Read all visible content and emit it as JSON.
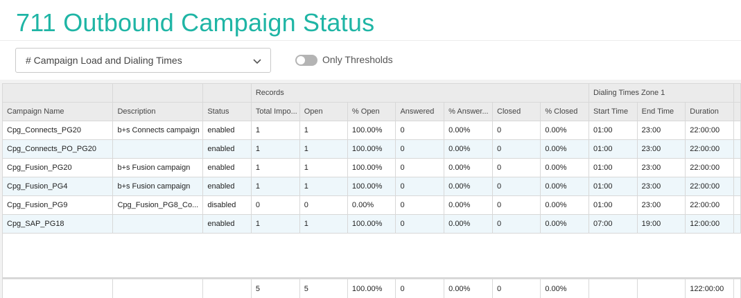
{
  "page": {
    "title": "711 Outbound Campaign Status"
  },
  "toolbar": {
    "view_select": {
      "value": "# Campaign Load and Dialing Times",
      "icon": "chevron-down-icon"
    },
    "threshold_toggle": {
      "label": "Only Thresholds",
      "state": "off"
    }
  },
  "colors": {
    "title": "#1fb5a5",
    "header_bg": "#ebebeb",
    "alt_row_bg": "#eef7fb"
  },
  "grid": {
    "group_headers": {
      "records": "Records",
      "dialing": "Dialing Times Zone 1"
    },
    "columns": [
      "Campaign Name",
      "Description",
      "Status",
      "Total Impo...",
      "Open",
      "% Open",
      "Answered",
      "% Answer...",
      "Closed",
      "% Closed",
      "Start Time",
      "End Time",
      "Duration"
    ],
    "rows": [
      [
        "Cpg_Connects_PG20",
        "b+s Connects campaign",
        "enabled",
        "1",
        "1",
        "100.00%",
        "0",
        "0.00%",
        "0",
        "0.00%",
        "01:00",
        "23:00",
        "22:00:00"
      ],
      [
        "Cpg_Connects_PO_PG20",
        "",
        "enabled",
        "1",
        "1",
        "100.00%",
        "0",
        "0.00%",
        "0",
        "0.00%",
        "01:00",
        "23:00",
        "22:00:00"
      ],
      [
        "Cpg_Fusion_PG20",
        "b+s Fusion campaign",
        "enabled",
        "1",
        "1",
        "100.00%",
        "0",
        "0.00%",
        "0",
        "0.00%",
        "01:00",
        "23:00",
        "22:00:00"
      ],
      [
        "Cpg_Fusion_PG4",
        "b+s Fusion campaign",
        "enabled",
        "1",
        "1",
        "100.00%",
        "0",
        "0.00%",
        "0",
        "0.00%",
        "01:00",
        "23:00",
        "22:00:00"
      ],
      [
        "Cpg_Fusion_PG9",
        "Cpg_Fusion_PG8_Co...",
        "disabled",
        "0",
        "0",
        "0.00%",
        "0",
        "0.00%",
        "0",
        "0.00%",
        "01:00",
        "23:00",
        "22:00:00"
      ],
      [
        "Cpg_SAP_PG18",
        "",
        "enabled",
        "1",
        "1",
        "100.00%",
        "0",
        "0.00%",
        "0",
        "0.00%",
        "07:00",
        "19:00",
        "12:00:00"
      ]
    ],
    "totals": [
      "",
      "",
      "",
      "5",
      "5",
      "100.00%",
      "0",
      "0.00%",
      "0",
      "0.00%",
      "",
      "",
      "122:00:00"
    ]
  }
}
